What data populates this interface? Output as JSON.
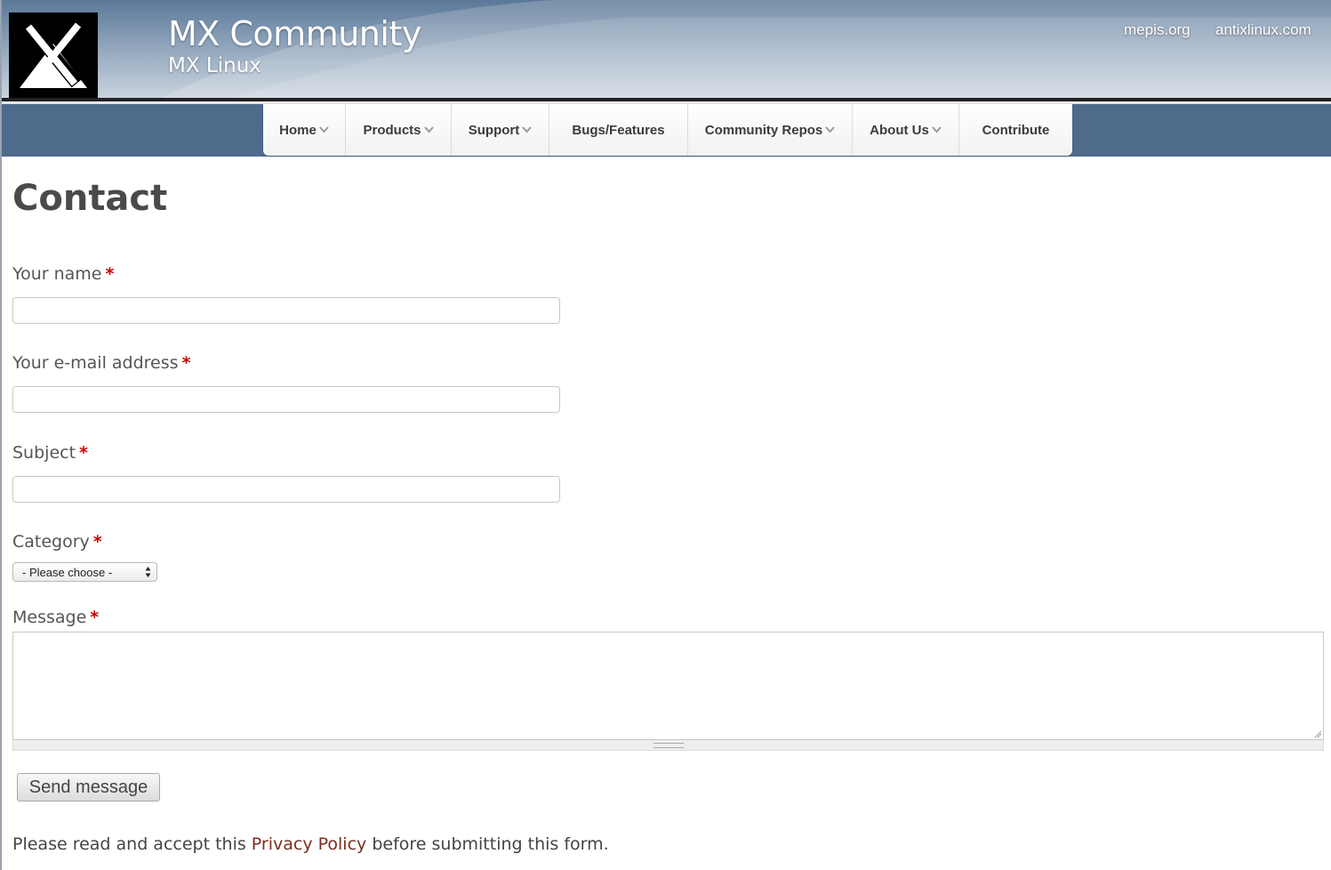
{
  "header": {
    "site_name": "MX Community",
    "slogan": "MX Linux",
    "links": [
      "mepis.org",
      "antixlinux.com"
    ]
  },
  "nav": {
    "items": [
      {
        "label": "Home",
        "has_dropdown": true
      },
      {
        "label": "Products",
        "has_dropdown": true
      },
      {
        "label": "Support",
        "has_dropdown": true
      },
      {
        "label": "Bugs/Features",
        "has_dropdown": false
      },
      {
        "label": "Community Repos",
        "has_dropdown": true
      },
      {
        "label": "About Us",
        "has_dropdown": true
      },
      {
        "label": "Contribute",
        "has_dropdown": false
      }
    ]
  },
  "page": {
    "title": "Contact"
  },
  "form": {
    "required_marker": "*",
    "name_label": "Your name",
    "name_value": "",
    "email_label": "Your e-mail address",
    "email_value": "",
    "subject_label": "Subject",
    "subject_value": "",
    "category_label": "Category",
    "category_selected": "- Please choose -",
    "message_label": "Message",
    "message_value": "",
    "submit_label": "Send message"
  },
  "footer_note": {
    "before": "Please read and accept this ",
    "link_text": "Privacy Policy",
    "after": " before submitting this form."
  },
  "colors": {
    "nav_bar": "#4e6b8c",
    "required": "#cc0000",
    "link": "#7a2e1e"
  }
}
